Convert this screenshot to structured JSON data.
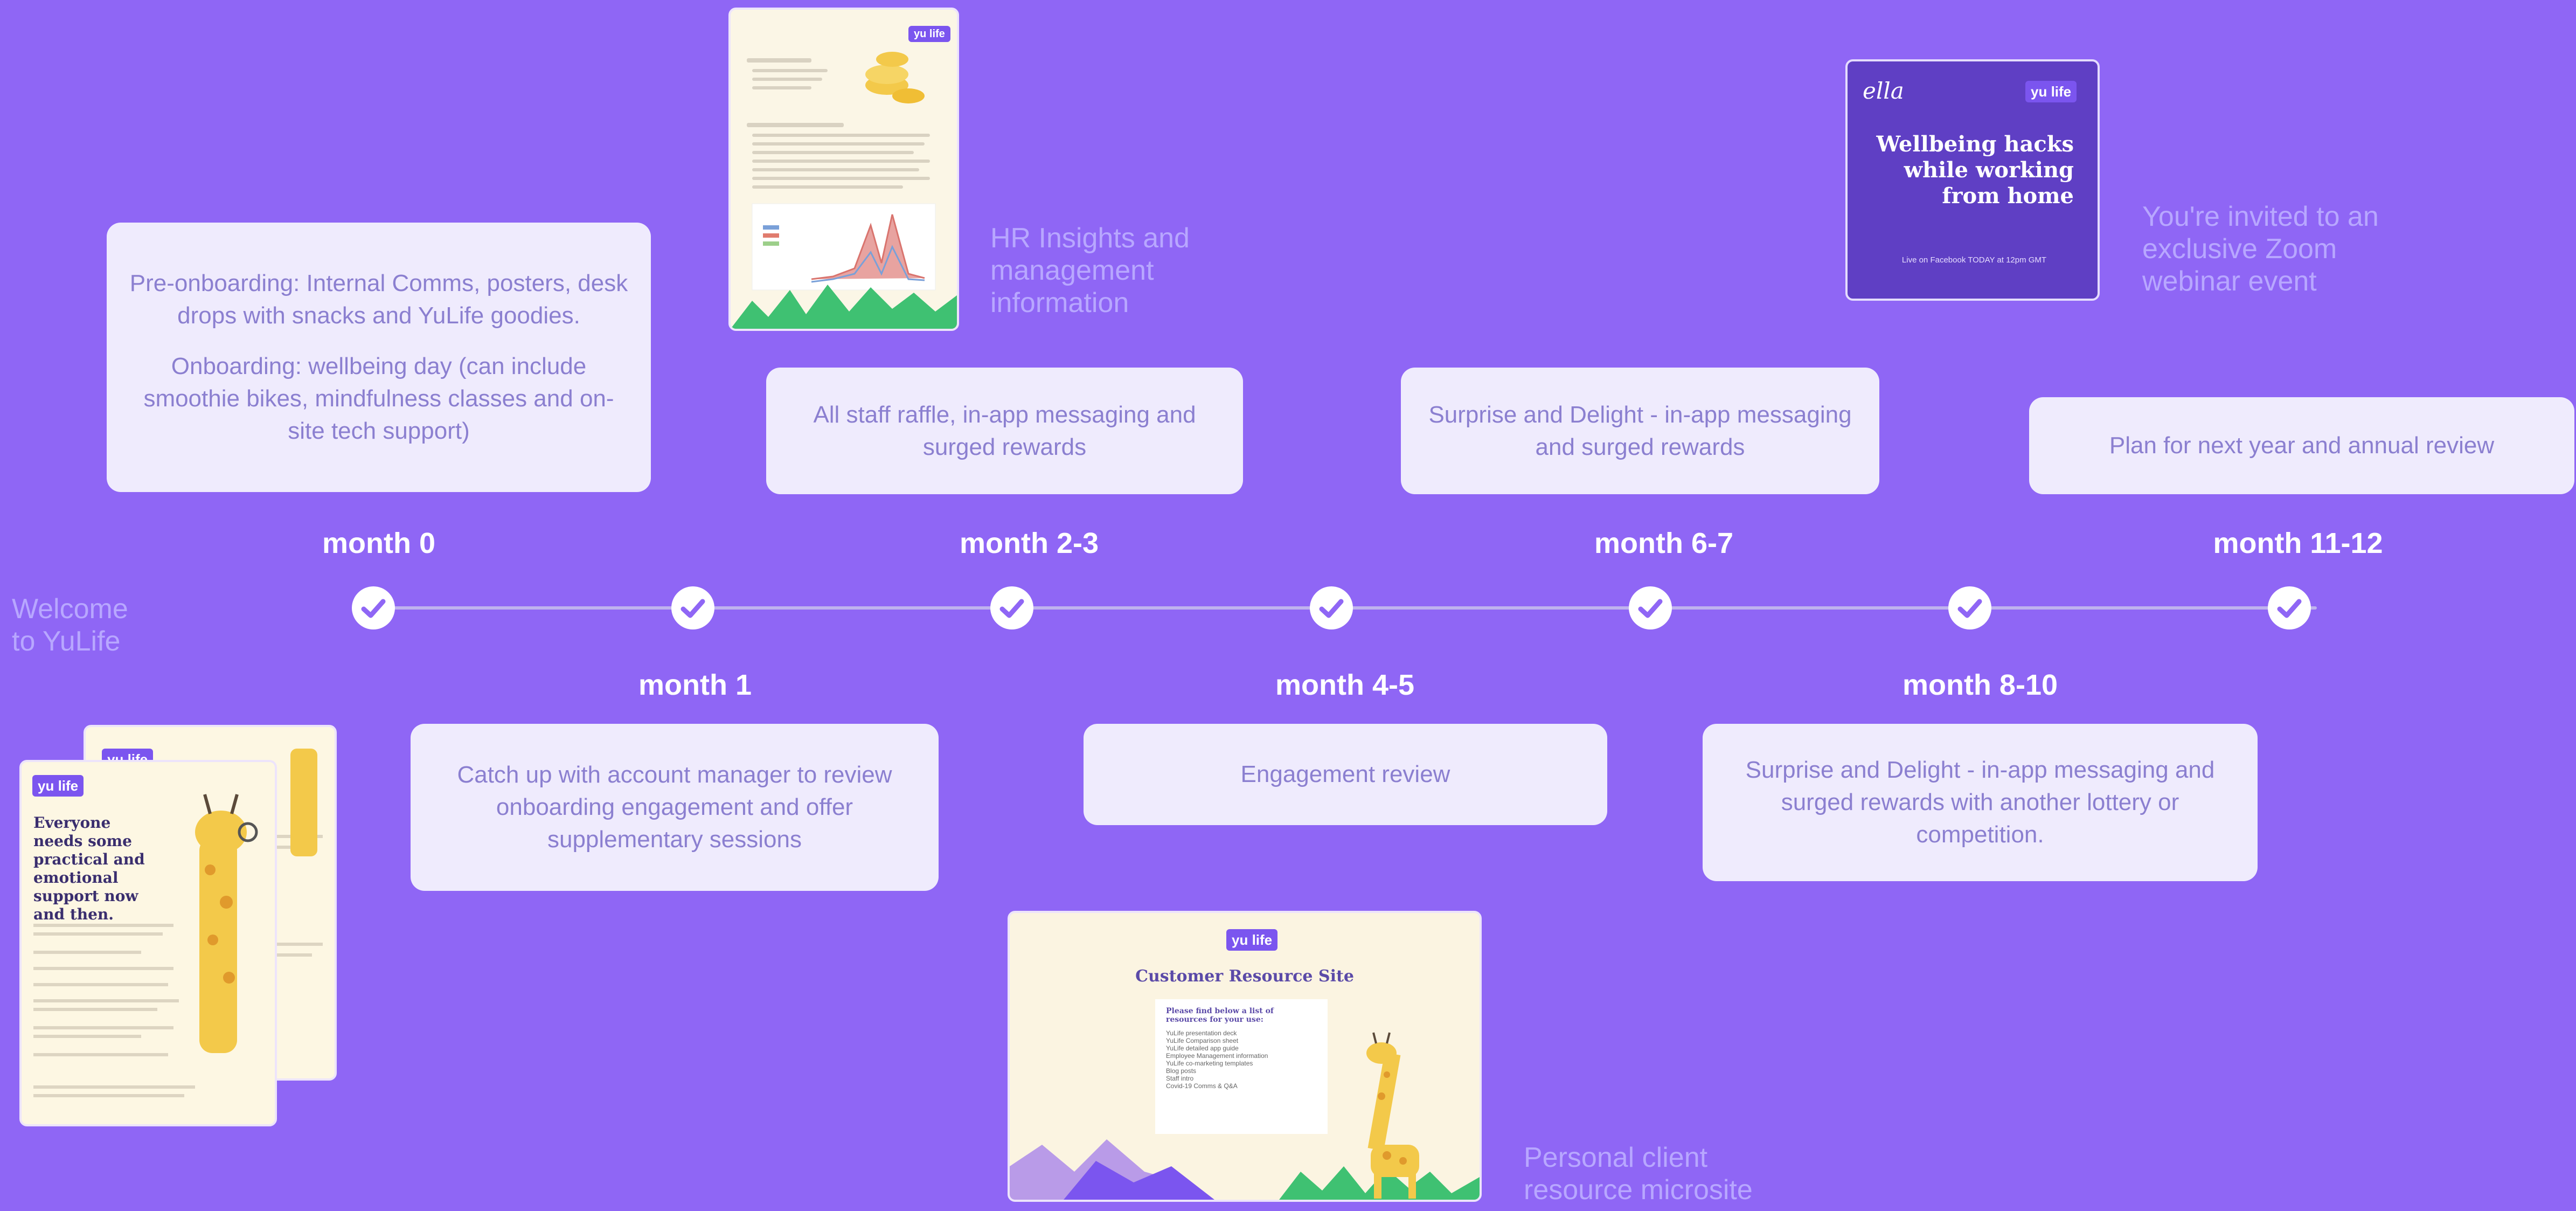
{
  "welcome": "Welcome\nto YuLife",
  "timeline": {
    "top_cards": [
      {
        "paragraphs": [
          "Pre-onboarding: Internal Comms, posters, desk drops with snacks and YuLife goodies.",
          "Onboarding: wellbeing day (can include smoothie bikes, mindfulness classes and on-site tech support)"
        ]
      },
      {
        "paragraphs": [
          "All staff raffle, in-app messaging and surged rewards"
        ]
      },
      {
        "paragraphs": [
          "Surprise and Delight - in-app messaging and surged rewards"
        ]
      },
      {
        "paragraphs": [
          "Plan for next year and annual review"
        ]
      }
    ],
    "bottom_cards": [
      {
        "paragraphs": [
          "Catch up with account manager to review onboarding engagement and offer supplementary sessions"
        ]
      },
      {
        "paragraphs": [
          "Engagement review"
        ]
      },
      {
        "paragraphs": [
          "Surprise and Delight - in-app messaging and surged rewards with another lottery or competition."
        ]
      }
    ],
    "top_months": [
      "month 0",
      "month 2-3",
      "month 6-7",
      "month 11-12"
    ],
    "bottom_months": [
      "month 1",
      "month 4-5",
      "month 8-10"
    ],
    "check_icon_count": 7
  },
  "captions": {
    "hr_insights": "HR Insights and\nmanagement\ninformation",
    "webinar": "You're invited to an\nexclusive Zoom\nwebinar event",
    "microsite": "Personal client\nresource microsite"
  },
  "webinar_thumb": {
    "brand": "ella",
    "logo": "yu life",
    "title": "Wellbeing hacks\nwhile working\nfrom home",
    "footer": "Live on Facebook TODAY at 12pm GMT"
  },
  "resource_thumb": {
    "logo": "yu life",
    "title": "Customer Resource Site",
    "intro": "Please find below a list of resources for your use:",
    "items": [
      "YuLife presentation deck",
      "YuLife Comparison sheet",
      "YuLife detailed app guide",
      "Employee Management information",
      "YuLife co-marketing templates",
      "Blog posts",
      "Staff intro",
      "Covid-19 Comms & Q&A"
    ]
  },
  "leaflet_thumb": {
    "logo": "yu life",
    "title": "Everyone needs some practical and emotional support now and then."
  },
  "hr_thumb": {
    "logo": "yu life"
  },
  "colors": {
    "background": "#8f66f5",
    "card": "#efebfd",
    "card_text": "#8b7fd0",
    "caption": "#b8a7ff",
    "accent": "#7b55ef"
  }
}
